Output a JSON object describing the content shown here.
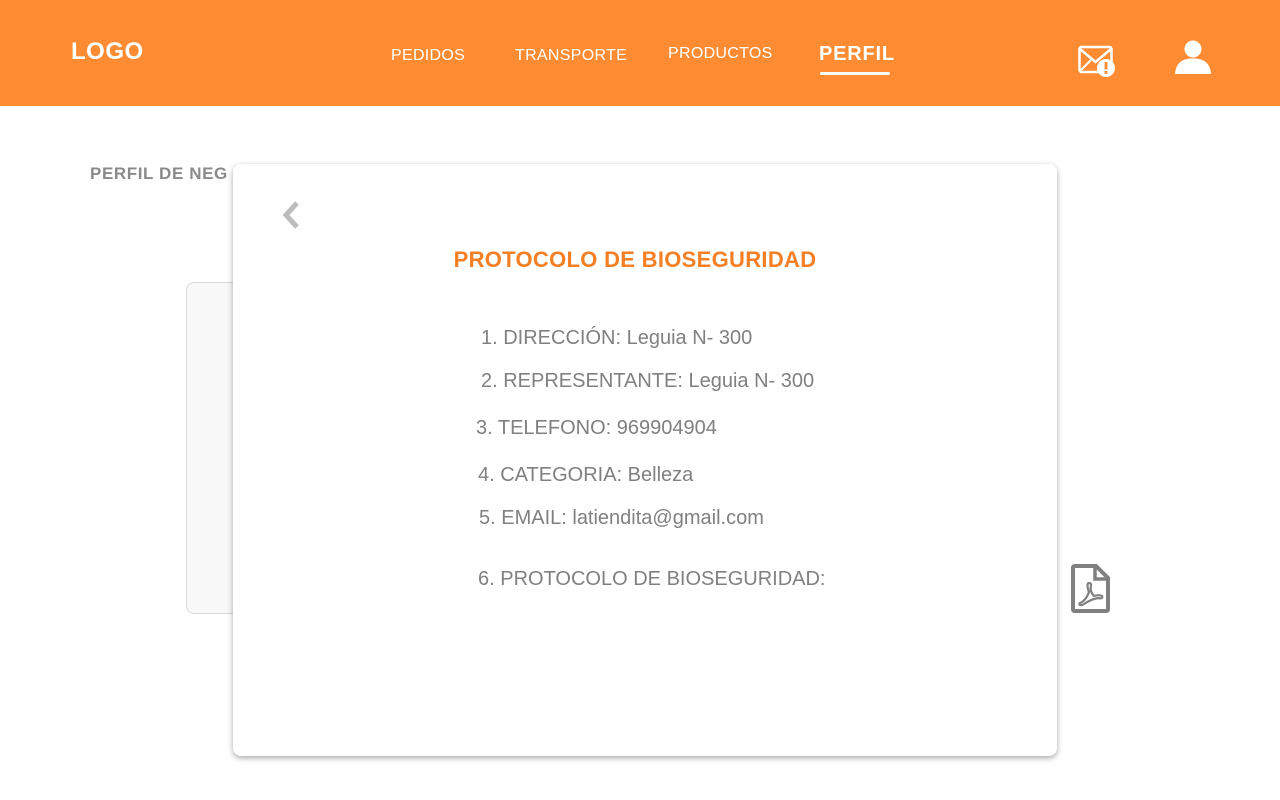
{
  "header": {
    "logo": "LOGO",
    "nav": {
      "pedidos": "PEDIDOS",
      "transporte": "TRANSPORTE",
      "productos": "PRODUCTOS",
      "perfil": "PERFIL"
    },
    "icons": {
      "messages": "mail-alert-icon",
      "user": "user-icon"
    }
  },
  "page": {
    "section_title": "PERFIL DE NEG"
  },
  "modal": {
    "title": "PROTOCOLO DE BIOSEGURIDAD",
    "items": [
      "1. DIRECCIÓN: Leguia N- 300",
      "2. REPRESENTANTE: Leguia N- 300",
      "3. TELEFONO: 969904904",
      "4. CATEGORIA: Belleza",
      "5. EMAIL: latiendita@gmail.com",
      "6. PROTOCOLO DE BIOSEGURIDAD:"
    ]
  },
  "colors": {
    "brand": "#ff8c33",
    "title_accent": "#f47f25",
    "text_gray": "#808080"
  }
}
